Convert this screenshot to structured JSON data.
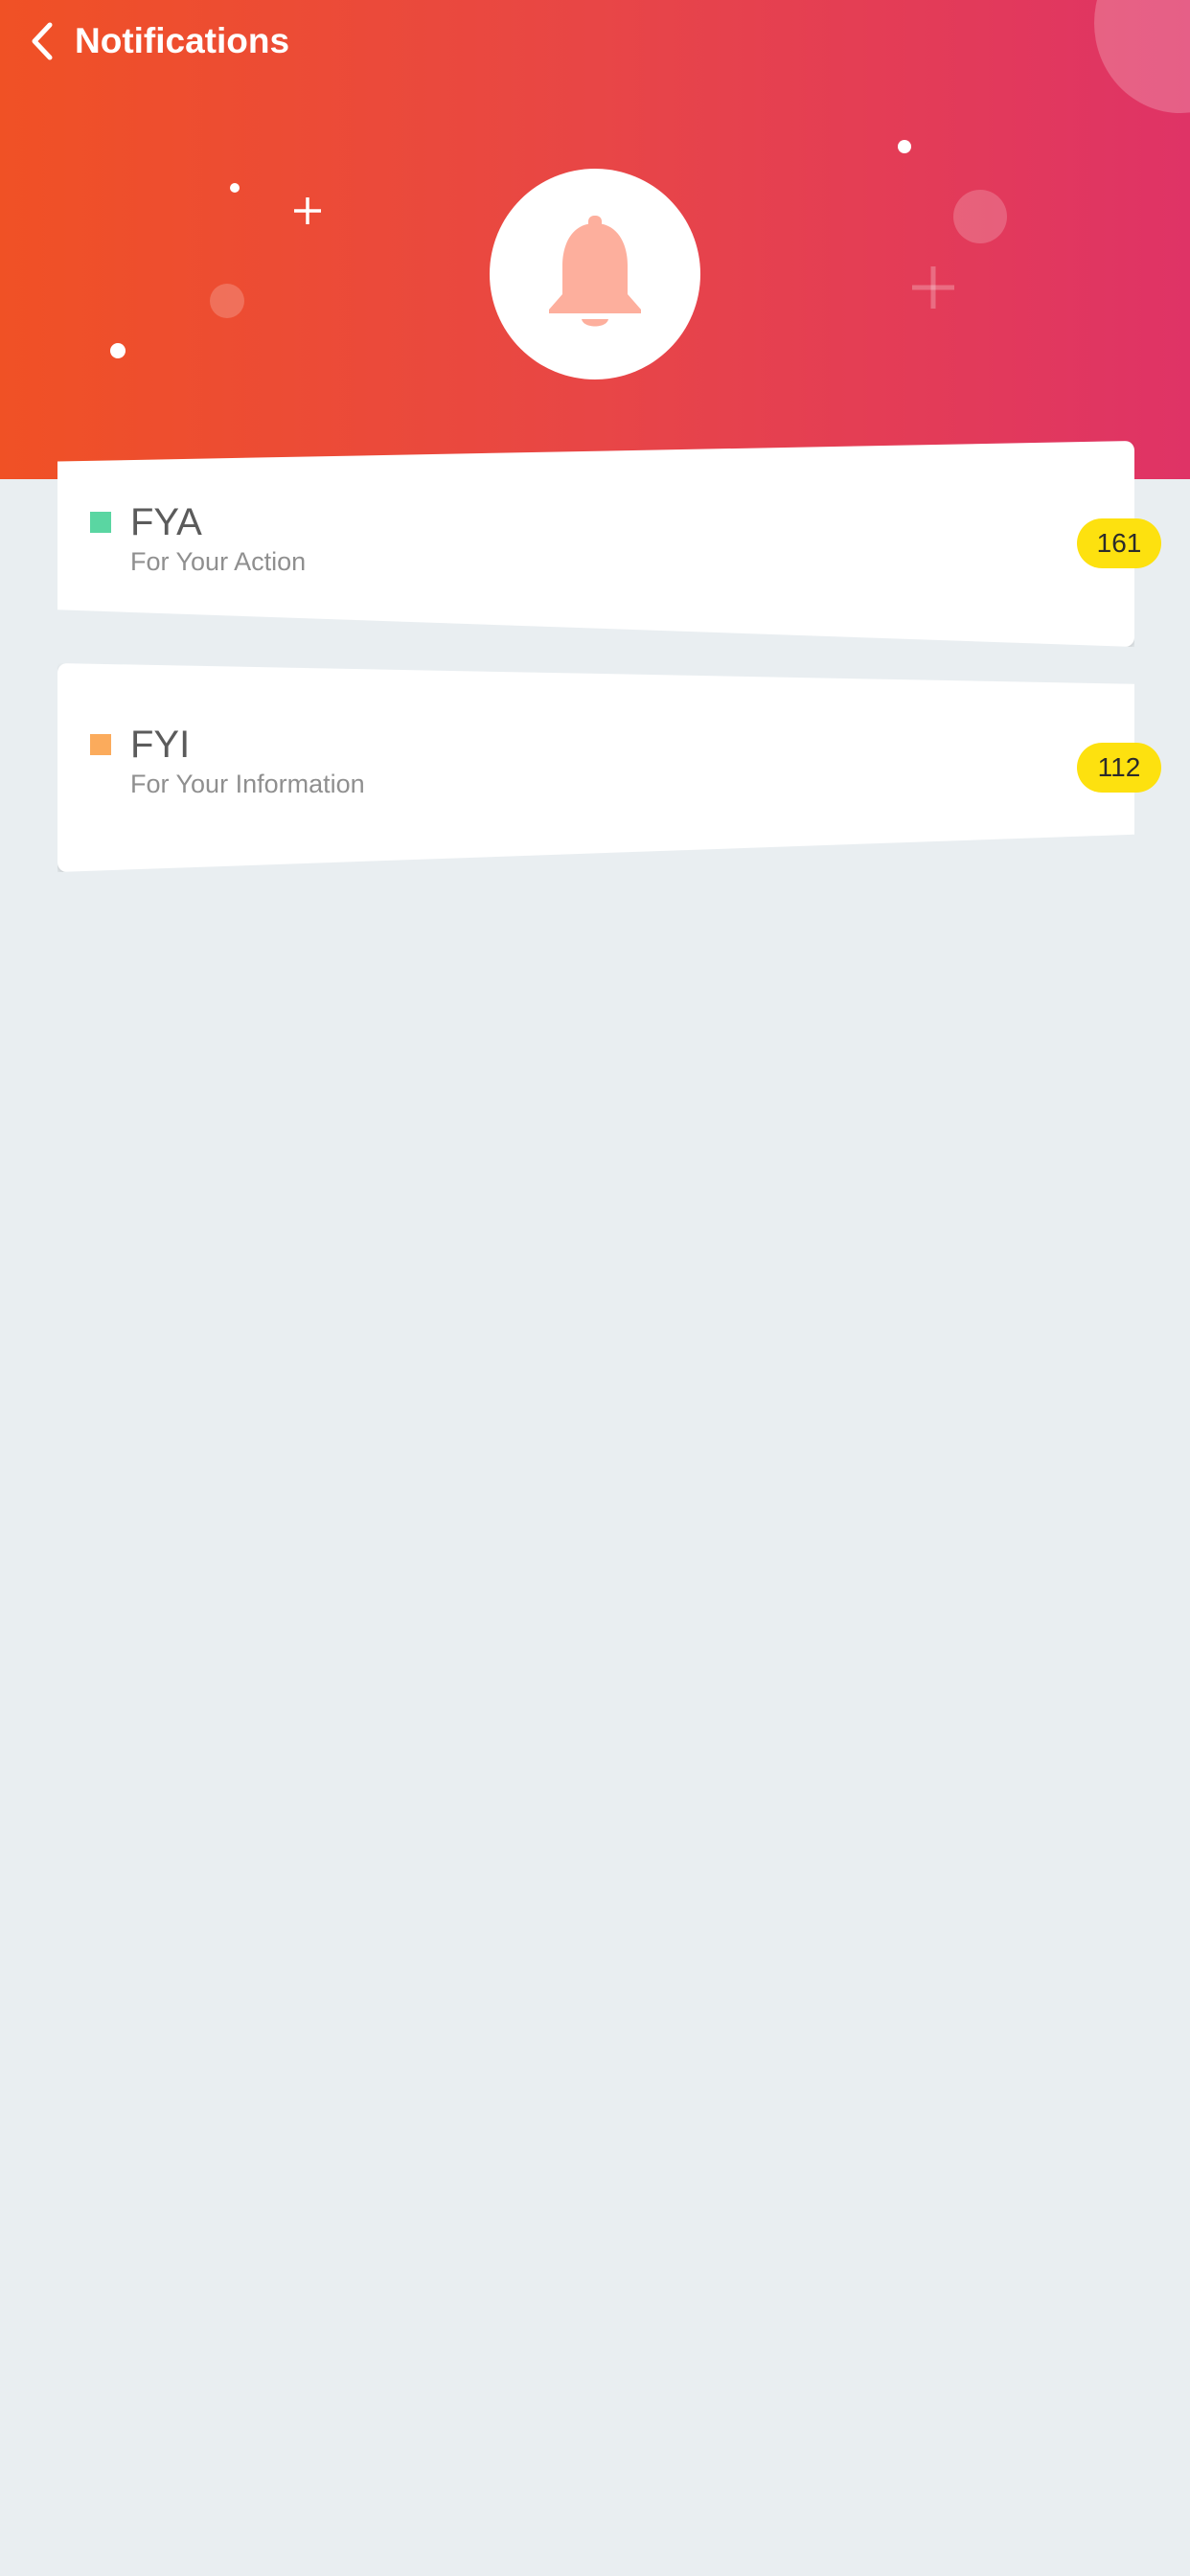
{
  "header": {
    "title": "Notifications",
    "back_icon": "chevron-left-icon",
    "hero_icon": "bell-icon"
  },
  "notifications": [
    {
      "title": "FYA",
      "subtitle": "For Your Action",
      "count": "161",
      "marker_color": "#5ad6a2"
    },
    {
      "title": "FYI",
      "subtitle": "For Your Information",
      "count": "112",
      "marker_color": "#fbab5c"
    }
  ],
  "colors": {
    "header_gradient_start": "#f05125",
    "header_gradient_end": "#df3366",
    "badge": "#fde10f",
    "background": "#e9eef1"
  }
}
